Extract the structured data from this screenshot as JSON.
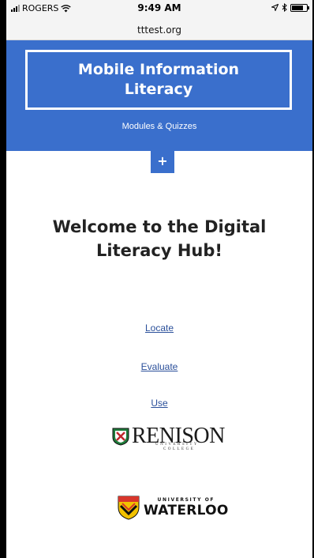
{
  "status_bar": {
    "carrier": "ROGERS",
    "time": "9:49 AM",
    "battery_level": 0.8
  },
  "browser": {
    "url": "tttest.org"
  },
  "header": {
    "title": "Mobile Information Literacy",
    "subtitle": "Modules & Quizzes",
    "menu_toggle": "+",
    "background_color": "#3a6fcc"
  },
  "main": {
    "heading": "Welcome to the Digital Literacy Hub!",
    "links": [
      {
        "label": "Locate"
      },
      {
        "label": "Evaluate"
      },
      {
        "label": "Use"
      }
    ]
  },
  "logos": {
    "renison": {
      "name": "RENISON",
      "lines": [
        "UNIVERSITY",
        "COLLEGE"
      ]
    },
    "waterloo": {
      "line1": "UNIVERSITY OF",
      "line2": "WATERLOO"
    }
  },
  "icons": [
    "signal-icon",
    "wifi-icon",
    "location-icon",
    "bluetooth-icon",
    "battery-icon",
    "renison-crest-icon",
    "waterloo-crest-icon"
  ]
}
